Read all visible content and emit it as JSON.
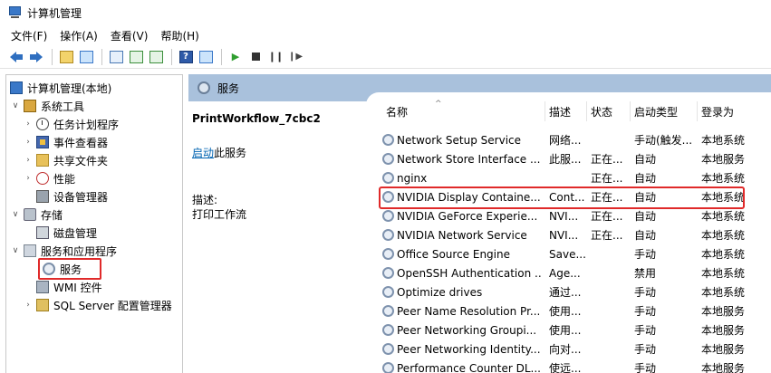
{
  "window": {
    "title": "计算机管理",
    "icon": "computer-management-icon"
  },
  "menu": [
    "文件(F)",
    "操作(A)",
    "查看(V)",
    "帮助(H)"
  ],
  "toolbar": {
    "icons": [
      "back-arrow-icon",
      "forward-arrow-icon",
      "up-folder-icon",
      "show-tree-icon",
      "properties-icon",
      "refresh-icon",
      "export-icon",
      "help-icon",
      "action-pane-icon",
      "start-service-icon",
      "stop-service-icon",
      "pause-service-icon",
      "resume-service-icon"
    ],
    "help_label": "?"
  },
  "tree": {
    "root": "计算机管理(本地)",
    "items": [
      {
        "label": "系统工具",
        "expander": "∨"
      },
      {
        "label": "任务计划程序",
        "expander": "›"
      },
      {
        "label": "事件查看器",
        "expander": "›"
      },
      {
        "label": "共享文件夹",
        "expander": "›"
      },
      {
        "label": "性能",
        "expander": "›"
      },
      {
        "label": "设备管理器",
        "expander": ""
      },
      {
        "label": "存储",
        "expander": "∨"
      },
      {
        "label": "磁盘管理",
        "expander": ""
      },
      {
        "label": "服务和应用程序",
        "expander": "∨"
      },
      {
        "label": "服务",
        "expander": ""
      },
      {
        "label": "WMI 控件",
        "expander": ""
      },
      {
        "label": "SQL Server 配置管理器",
        "expander": "›"
      }
    ]
  },
  "pane": {
    "title": "服务",
    "selected_service": "PrintWorkflow_7cbc2",
    "start_link": "启动",
    "start_suffix": "此服务",
    "description_label": "描述:",
    "description_text": "打印工作流"
  },
  "table": {
    "sort_indicator": "^",
    "columns": [
      "名称",
      "描述",
      "状态",
      "启动类型",
      "登录为"
    ],
    "rows": [
      [
        "Network Setup Service",
        "网络...",
        "",
        "手动(触发...",
        "本地系统"
      ],
      [
        "Network Store Interface ...",
        "此服...",
        "正在...",
        "自动",
        "本地服务"
      ],
      [
        "nginx",
        "",
        "正在...",
        "自动",
        "本地系统"
      ],
      [
        "NVIDIA Display Containe...",
        "Cont...",
        "正在...",
        "自动",
        "本地系统"
      ],
      [
        "NVIDIA GeForce Experie...",
        "NVI...",
        "正在...",
        "自动",
        "本地系统"
      ],
      [
        "NVIDIA Network Service",
        "NVI...",
        "正在...",
        "自动",
        "本地系统"
      ],
      [
        "Office  Source Engine",
        "Save...",
        "",
        "手动",
        "本地系统"
      ],
      [
        "OpenSSH Authentication ...",
        "Age...",
        "",
        "禁用",
        "本地系统"
      ],
      [
        "Optimize drives",
        "通过...",
        "",
        "手动",
        "本地系统"
      ],
      [
        "Peer Name Resolution Pr...",
        "使用...",
        "",
        "手动",
        "本地服务"
      ],
      [
        "Peer Networking Groupi...",
        "使用...",
        "",
        "手动",
        "本地服务"
      ],
      [
        "Peer Networking Identity...",
        "向对...",
        "",
        "手动",
        "本地服务"
      ],
      [
        "Performance Counter DL...",
        "使远...",
        "",
        "手动",
        "本地服务"
      ]
    ]
  },
  "colors": {
    "header_band": "#a9c1dc",
    "highlight": "#e02a2a",
    "link": "#0063b1"
  }
}
